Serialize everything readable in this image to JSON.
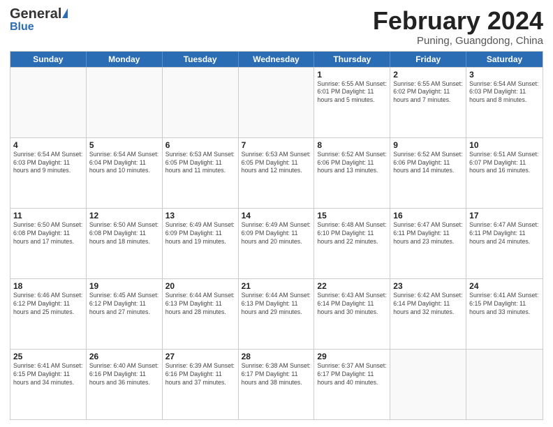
{
  "header": {
    "logo_general": "General",
    "logo_blue": "Blue",
    "month_title": "February 2024",
    "location": "Puning, Guangdong, China"
  },
  "weekdays": [
    "Sunday",
    "Monday",
    "Tuesday",
    "Wednesday",
    "Thursday",
    "Friday",
    "Saturday"
  ],
  "rows": [
    [
      {
        "day": "",
        "info": ""
      },
      {
        "day": "",
        "info": ""
      },
      {
        "day": "",
        "info": ""
      },
      {
        "day": "",
        "info": ""
      },
      {
        "day": "1",
        "info": "Sunrise: 6:55 AM\nSunset: 6:01 PM\nDaylight: 11 hours and 5 minutes."
      },
      {
        "day": "2",
        "info": "Sunrise: 6:55 AM\nSunset: 6:02 PM\nDaylight: 11 hours and 7 minutes."
      },
      {
        "day": "3",
        "info": "Sunrise: 6:54 AM\nSunset: 6:03 PM\nDaylight: 11 hours and 8 minutes."
      }
    ],
    [
      {
        "day": "4",
        "info": "Sunrise: 6:54 AM\nSunset: 6:03 PM\nDaylight: 11 hours and 9 minutes."
      },
      {
        "day": "5",
        "info": "Sunrise: 6:54 AM\nSunset: 6:04 PM\nDaylight: 11 hours and 10 minutes."
      },
      {
        "day": "6",
        "info": "Sunrise: 6:53 AM\nSunset: 6:05 PM\nDaylight: 11 hours and 11 minutes."
      },
      {
        "day": "7",
        "info": "Sunrise: 6:53 AM\nSunset: 6:05 PM\nDaylight: 11 hours and 12 minutes."
      },
      {
        "day": "8",
        "info": "Sunrise: 6:52 AM\nSunset: 6:06 PM\nDaylight: 11 hours and 13 minutes."
      },
      {
        "day": "9",
        "info": "Sunrise: 6:52 AM\nSunset: 6:06 PM\nDaylight: 11 hours and 14 minutes."
      },
      {
        "day": "10",
        "info": "Sunrise: 6:51 AM\nSunset: 6:07 PM\nDaylight: 11 hours and 16 minutes."
      }
    ],
    [
      {
        "day": "11",
        "info": "Sunrise: 6:50 AM\nSunset: 6:08 PM\nDaylight: 11 hours and 17 minutes."
      },
      {
        "day": "12",
        "info": "Sunrise: 6:50 AM\nSunset: 6:08 PM\nDaylight: 11 hours and 18 minutes."
      },
      {
        "day": "13",
        "info": "Sunrise: 6:49 AM\nSunset: 6:09 PM\nDaylight: 11 hours and 19 minutes."
      },
      {
        "day": "14",
        "info": "Sunrise: 6:49 AM\nSunset: 6:09 PM\nDaylight: 11 hours and 20 minutes."
      },
      {
        "day": "15",
        "info": "Sunrise: 6:48 AM\nSunset: 6:10 PM\nDaylight: 11 hours and 22 minutes."
      },
      {
        "day": "16",
        "info": "Sunrise: 6:47 AM\nSunset: 6:11 PM\nDaylight: 11 hours and 23 minutes."
      },
      {
        "day": "17",
        "info": "Sunrise: 6:47 AM\nSunset: 6:11 PM\nDaylight: 11 hours and 24 minutes."
      }
    ],
    [
      {
        "day": "18",
        "info": "Sunrise: 6:46 AM\nSunset: 6:12 PM\nDaylight: 11 hours and 25 minutes."
      },
      {
        "day": "19",
        "info": "Sunrise: 6:45 AM\nSunset: 6:12 PM\nDaylight: 11 hours and 27 minutes."
      },
      {
        "day": "20",
        "info": "Sunrise: 6:44 AM\nSunset: 6:13 PM\nDaylight: 11 hours and 28 minutes."
      },
      {
        "day": "21",
        "info": "Sunrise: 6:44 AM\nSunset: 6:13 PM\nDaylight: 11 hours and 29 minutes."
      },
      {
        "day": "22",
        "info": "Sunrise: 6:43 AM\nSunset: 6:14 PM\nDaylight: 11 hours and 30 minutes."
      },
      {
        "day": "23",
        "info": "Sunrise: 6:42 AM\nSunset: 6:14 PM\nDaylight: 11 hours and 32 minutes."
      },
      {
        "day": "24",
        "info": "Sunrise: 6:41 AM\nSunset: 6:15 PM\nDaylight: 11 hours and 33 minutes."
      }
    ],
    [
      {
        "day": "25",
        "info": "Sunrise: 6:41 AM\nSunset: 6:15 PM\nDaylight: 11 hours and 34 minutes."
      },
      {
        "day": "26",
        "info": "Sunrise: 6:40 AM\nSunset: 6:16 PM\nDaylight: 11 hours and 36 minutes."
      },
      {
        "day": "27",
        "info": "Sunrise: 6:39 AM\nSunset: 6:16 PM\nDaylight: 11 hours and 37 minutes."
      },
      {
        "day": "28",
        "info": "Sunrise: 6:38 AM\nSunset: 6:17 PM\nDaylight: 11 hours and 38 minutes."
      },
      {
        "day": "29",
        "info": "Sunrise: 6:37 AM\nSunset: 6:17 PM\nDaylight: 11 hours and 40 minutes."
      },
      {
        "day": "",
        "info": ""
      },
      {
        "day": "",
        "info": ""
      }
    ]
  ]
}
